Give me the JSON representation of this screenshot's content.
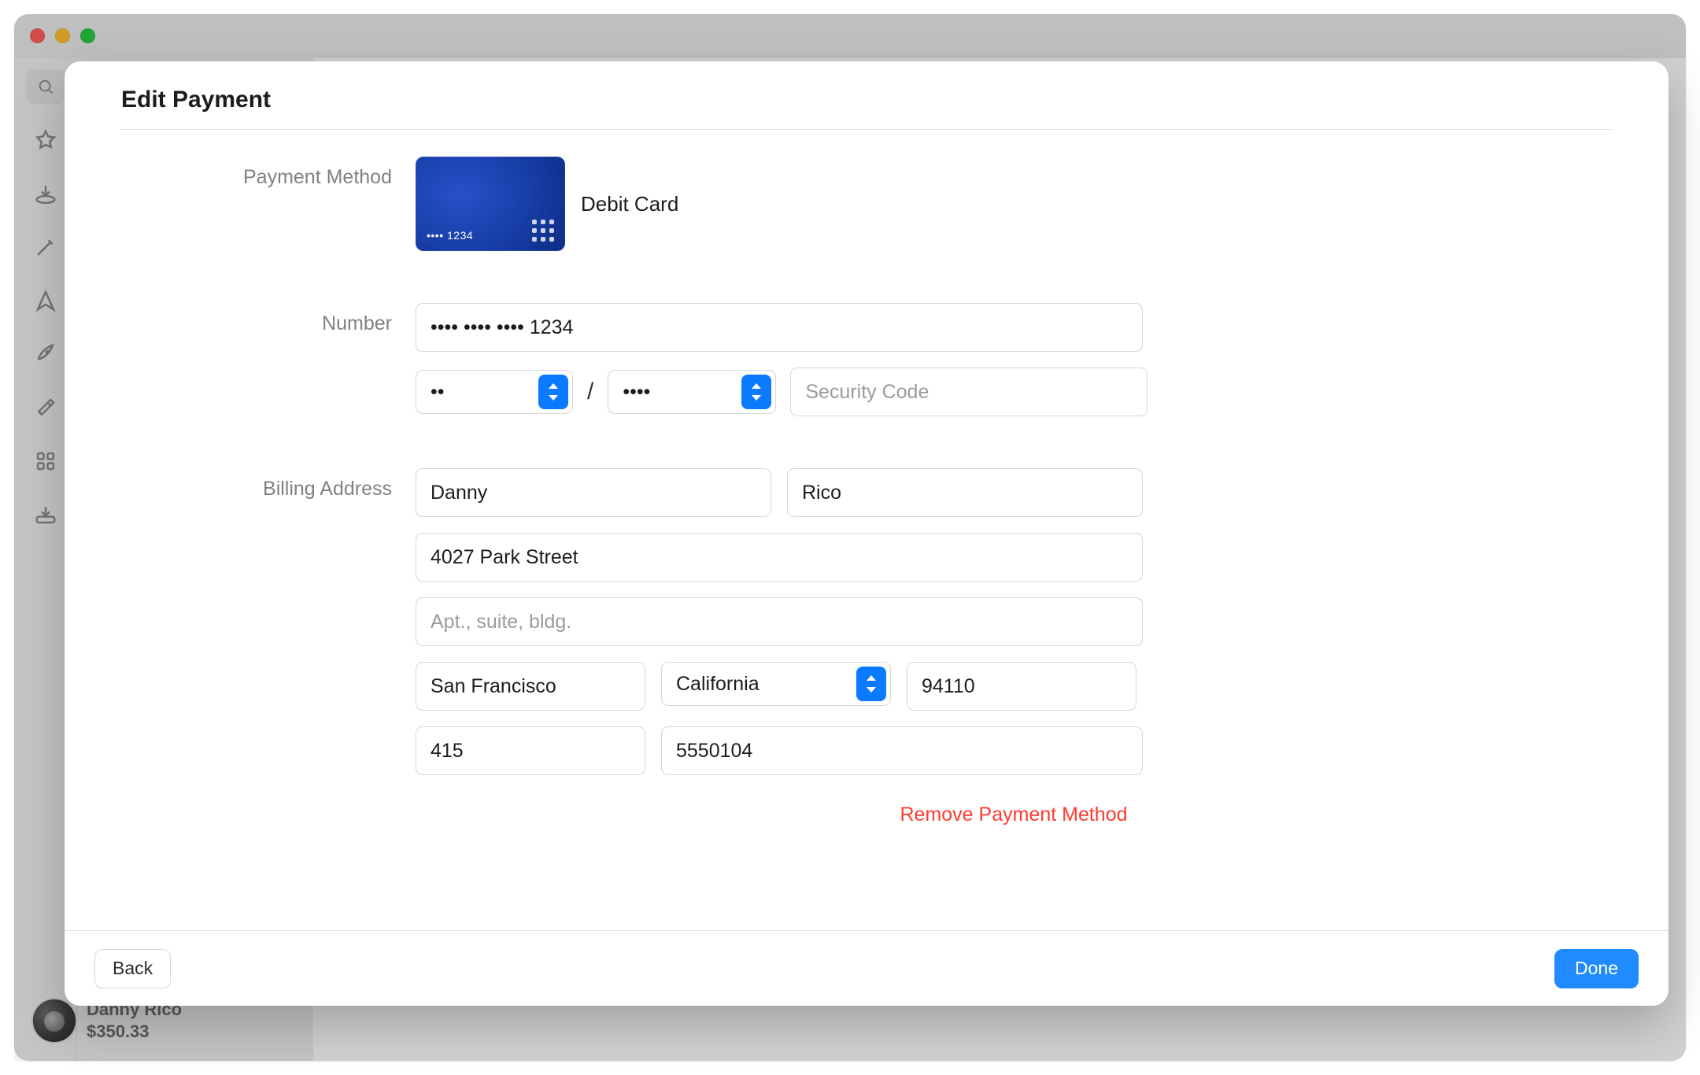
{
  "window": {
    "traffic": {
      "close": true,
      "min": true,
      "max": true
    }
  },
  "sidebar": {
    "search_placeholder": "",
    "icons": [
      "star",
      "download",
      "wand",
      "compass",
      "rocket",
      "hammer",
      "grid",
      "tray-arrow-down"
    ]
  },
  "account": {
    "name": "Danny Rico",
    "balance": "$350.33"
  },
  "sheet": {
    "title": "Edit Payment",
    "sections": {
      "payment_method": {
        "label": "Payment Method",
        "card_type": "Debit Card",
        "card_last4_preview": "•••• 1234"
      },
      "number": {
        "label": "Number",
        "masked": "•••• •••• •••• 1234",
        "exp_month": "••",
        "exp_year": "••••",
        "separator": "/",
        "cvv_placeholder": "Security Code"
      },
      "billing": {
        "label": "Billing Address",
        "first_name": "Danny",
        "last_name": "Rico",
        "street": "4027 Park Street",
        "street2_placeholder": "Apt., suite, bldg.",
        "city": "San Francisco",
        "state": "California",
        "zip": "94110",
        "phone_area": "415",
        "phone_number": "5550104"
      }
    },
    "remove": "Remove Payment Method",
    "footer": {
      "back": "Back",
      "done": "Done"
    }
  }
}
